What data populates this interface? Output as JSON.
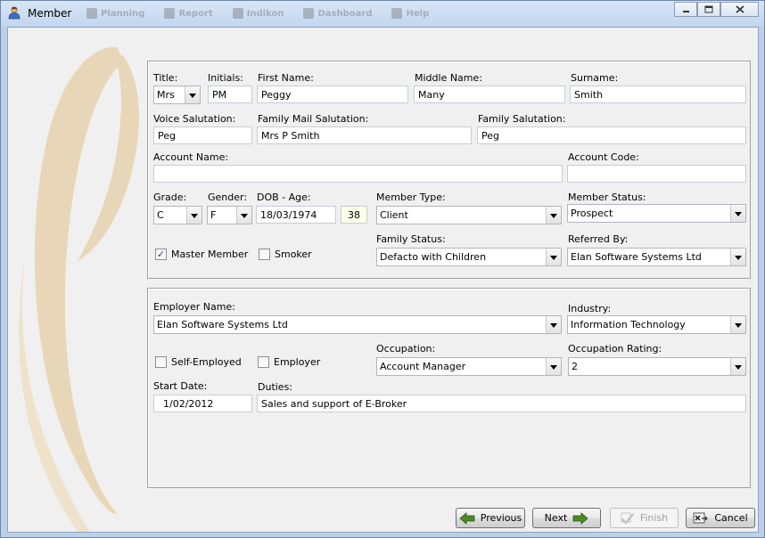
{
  "window": {
    "title": "Member",
    "ghost_tabs": [
      "Planning",
      "Report",
      "Indikon",
      "Dashboard",
      "Help"
    ]
  },
  "personal": {
    "title": {
      "label": "Title:",
      "value": "Mrs"
    },
    "initials": {
      "label": "Initials:",
      "value": "PM"
    },
    "first_name": {
      "label": "First Name:",
      "value": "Peggy"
    },
    "middle_name": {
      "label": "Middle Name:",
      "value": "Many"
    },
    "surname": {
      "label": "Surname:",
      "value": "Smith"
    },
    "voice_salutation": {
      "label": "Voice Salutation:",
      "value": "Peg"
    },
    "family_mail_salutation": {
      "label": "Family Mail Salutation:",
      "value": "Mrs P Smith"
    },
    "family_salutation": {
      "label": "Family Salutation:",
      "value": "Peg"
    },
    "account_name": {
      "label": "Account Name:",
      "value": ""
    },
    "account_code": {
      "label": "Account Code:",
      "value": ""
    },
    "grade": {
      "label": "Grade:",
      "value": "C"
    },
    "gender": {
      "label": "Gender:",
      "value": "F"
    },
    "dob": {
      "label": "DOB - Age:",
      "value": "18/03/1974",
      "age": "38"
    },
    "member_type": {
      "label": "Member Type:",
      "value": "Client"
    },
    "member_status": {
      "label": "Member Status:",
      "value": "Prospect"
    },
    "master_member": {
      "label": "Master Member",
      "checked": true
    },
    "smoker": {
      "label": "Smoker",
      "checked": false
    },
    "family_status": {
      "label": "Family Status:",
      "value": "Defacto with Children"
    },
    "referred_by": {
      "label": "Referred By:",
      "value": "Elan Software Systems Ltd"
    }
  },
  "employment": {
    "employer_name": {
      "label": "Employer Name:",
      "value": "Elan Software Systems Ltd"
    },
    "industry": {
      "label": "Industry:",
      "value": "Information Technology"
    },
    "self_employed": {
      "label": "Self-Employed",
      "checked": false
    },
    "employer": {
      "label": "Employer",
      "checked": false
    },
    "occupation": {
      "label": "Occupation:",
      "value": "Account Manager"
    },
    "occupation_rating": {
      "label": "Occupation Rating:",
      "value": "2"
    },
    "start_date": {
      "label": "Start Date:",
      "value": "1/02/2012"
    },
    "duties": {
      "label": "Duties:",
      "value": "Sales and support of E-Broker"
    }
  },
  "buttons": {
    "previous": "Previous",
    "next": "Next",
    "finish": "Finish",
    "cancel": "Cancel"
  },
  "colors": {
    "swirl": "#e8d6b8",
    "arrow_green": "#4d8a22",
    "readonly_bg": "#ffffe8"
  }
}
